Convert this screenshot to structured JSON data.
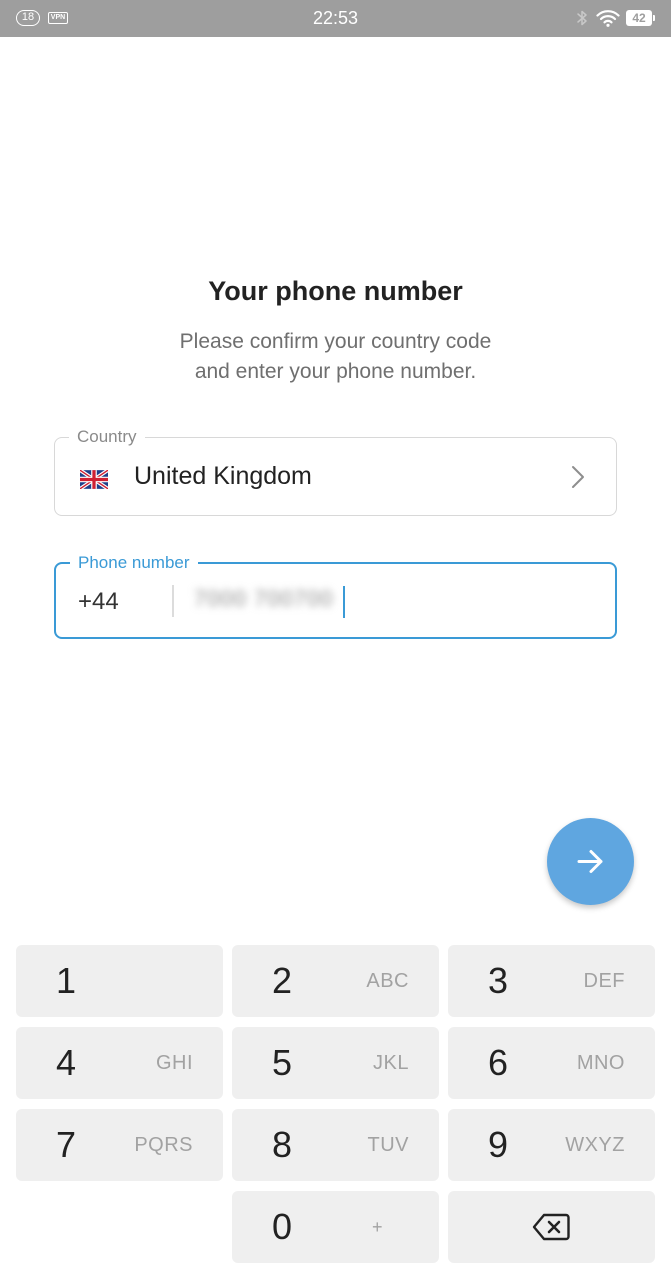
{
  "status_bar": {
    "notification_count": "18",
    "vpn_label": "VPN",
    "time": "22:53",
    "battery": "42",
    "icons": [
      "bluetooth-icon",
      "wifi-icon",
      "battery-icon"
    ]
  },
  "header": {
    "title": "Your phone number",
    "subtitle_line1": "Please confirm your country code",
    "subtitle_line2": "and enter your phone number."
  },
  "country_field": {
    "label": "Country",
    "value": "United Kingdom",
    "flag_icon": "uk-flag-icon",
    "chevron_icon": "chevron-right-icon"
  },
  "phone_field": {
    "label": "Phone number",
    "country_code": "+44",
    "number": "7000 700700"
  },
  "next_button": {
    "icon": "arrow-right-icon",
    "color": "#5fa6e0"
  },
  "keypad": {
    "keys": [
      {
        "digit": "1",
        "letters": ""
      },
      {
        "digit": "2",
        "letters": "ABC"
      },
      {
        "digit": "3",
        "letters": "DEF"
      },
      {
        "digit": "4",
        "letters": "GHI"
      },
      {
        "digit": "5",
        "letters": "JKL"
      },
      {
        "digit": "6",
        "letters": "MNO"
      },
      {
        "digit": "7",
        "letters": "PQRS"
      },
      {
        "digit": "8",
        "letters": "TUV"
      },
      {
        "digit": "9",
        "letters": "WXYZ"
      },
      {
        "digit": "0",
        "letters": "+"
      }
    ],
    "backspace_icon": "backspace-icon"
  },
  "colors": {
    "accent": "#3a9ad6",
    "status_bar": "#9e9e9e",
    "key_background": "#efefef"
  }
}
